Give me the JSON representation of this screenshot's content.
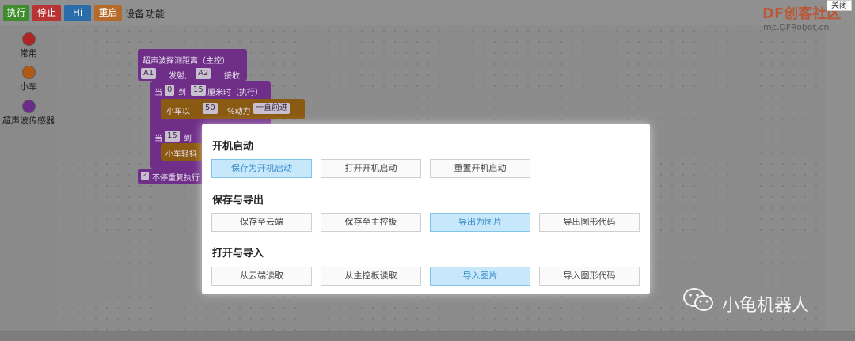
{
  "toolbar": {
    "run": "执行",
    "stop": "停止",
    "hi": "Hi",
    "restart": "重启",
    "device": "设备",
    "function": "功能",
    "colors": {
      "run": "#3f8c2e",
      "stop": "#b83434",
      "hi": "#2a6ca8",
      "restart": "#b56a2a"
    }
  },
  "sidebar": {
    "items": [
      {
        "label": "常用",
        "color": "#b02424"
      },
      {
        "label": "小车",
        "color": "#b25a14"
      },
      {
        "label": "超声波传感器",
        "color": "#6a2b8a"
      }
    ]
  },
  "blocks": {
    "head": "超声波探测距离（主控）",
    "emit_pin": "A1",
    "emit_label": "发射,",
    "recv_pin": "A2",
    "recv_label": "接收",
    "cond1_when": "当",
    "cond1_from": "0",
    "cond1_to_label": "到",
    "cond1_to": "15",
    "cond1_unit": "厘米时（执行）",
    "car_prefix": "小车以",
    "car_speed": "50",
    "car_power": "%动力",
    "car_dir": "一直前进",
    "cond2_when": "当",
    "cond2_from": "15",
    "cond2_to_label": "到",
    "car2": "小车轻抖",
    "repeat": "不停重复执行"
  },
  "watermark": {
    "brand": "DF创客社区",
    "url": "mc.DFRobot.cn",
    "close": "关闭",
    "author": "小龟机器人"
  },
  "dialog": {
    "sections": [
      {
        "title": "开机启动",
        "buttons": [
          {
            "label": "保存为开机启动",
            "active": true
          },
          {
            "label": "打开开机启动",
            "active": false
          },
          {
            "label": "重置开机启动",
            "active": false
          }
        ]
      },
      {
        "title": "保存与导出",
        "buttons": [
          {
            "label": "保存至云端",
            "active": false
          },
          {
            "label": "保存至主控板",
            "active": false
          },
          {
            "label": "导出为图片",
            "active": true
          },
          {
            "label": "导出图形代码",
            "active": false
          }
        ]
      },
      {
        "title": "打开与导入",
        "buttons": [
          {
            "label": "从云端读取",
            "active": false
          },
          {
            "label": "从主控板读取",
            "active": false
          },
          {
            "label": "导入图片",
            "active": true
          },
          {
            "label": "导入图形代码",
            "active": false
          }
        ]
      }
    ]
  }
}
